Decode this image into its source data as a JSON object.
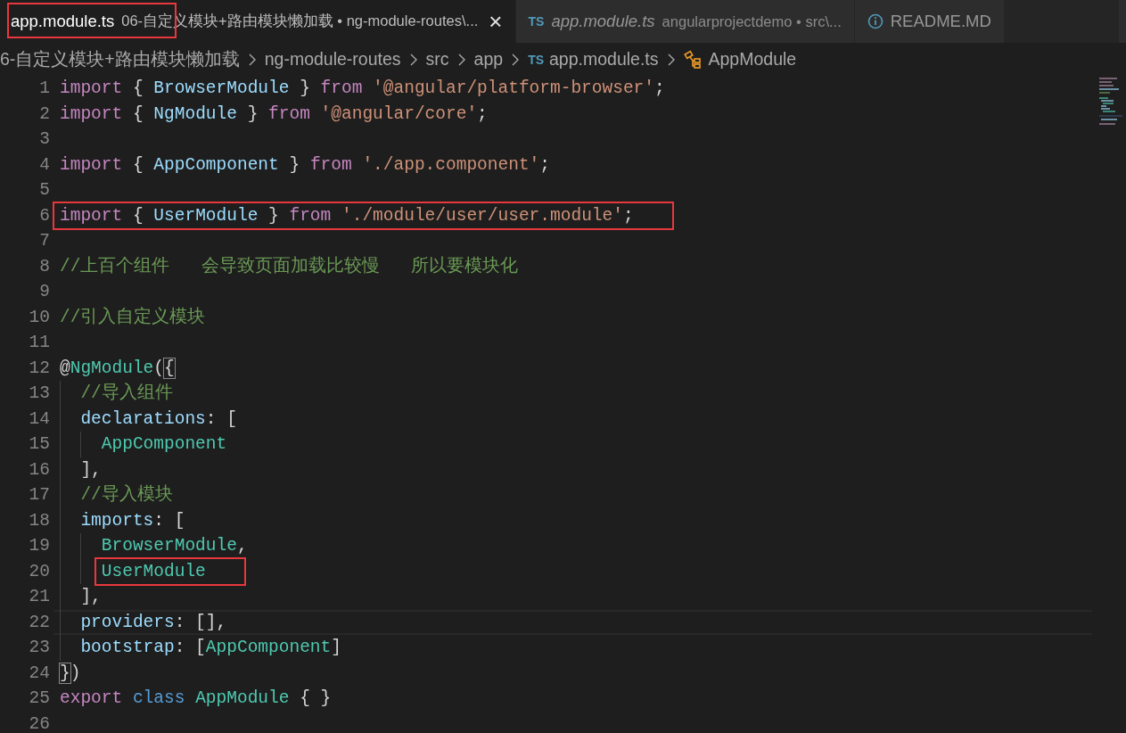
{
  "tabs": [
    {
      "kind": "plain",
      "name": "app.module.ts",
      "description": "06-自定义模块+路由模块懒加载 • ng-module-routes\\...",
      "selected": true,
      "italic": false,
      "highlighted": true,
      "close": "×"
    },
    {
      "kind": "ts",
      "icon": "TS",
      "name": "app.module.ts",
      "description": "angularprojectdemo • src\\...",
      "selected": false,
      "italic": true,
      "highlighted": false
    },
    {
      "kind": "info",
      "name": "README.MD",
      "selected": false,
      "italic": false,
      "highlighted": false
    }
  ],
  "breadcrumb": [
    {
      "kind": "folder",
      "label": "6-自定义模块+路由模块懒加载"
    },
    {
      "kind": "folder",
      "label": "ng-module-routes"
    },
    {
      "kind": "folder",
      "label": "src"
    },
    {
      "kind": "folder",
      "label": "app"
    },
    {
      "kind": "file",
      "icon": "TS",
      "label": "app.module.ts"
    },
    {
      "kind": "symbol",
      "label": "AppModule"
    }
  ],
  "lines": [
    {
      "number": "1",
      "highlighted": false,
      "current": false,
      "tokens": [
        {
          "kind": "keyword",
          "text": "import"
        },
        {
          "kind": "plain",
          "text": " { "
        },
        {
          "kind": "variable",
          "text": "BrowserModule"
        },
        {
          "kind": "plain",
          "text": " } "
        },
        {
          "kind": "keyword",
          "text": "from"
        },
        {
          "kind": "string",
          "text": " '@angular/platform-browser'"
        },
        {
          "kind": "plain",
          "text": ";"
        }
      ]
    },
    {
      "number": "2",
      "highlighted": false,
      "current": false,
      "tokens": [
        {
          "kind": "keyword",
          "text": "import"
        },
        {
          "kind": "plain",
          "text": " { "
        },
        {
          "kind": "variable",
          "text": "NgModule"
        },
        {
          "kind": "plain",
          "text": " } "
        },
        {
          "kind": "keyword",
          "text": "from"
        },
        {
          "kind": "string",
          "text": " '@angular/core'"
        },
        {
          "kind": "plain",
          "text": ";"
        }
      ]
    },
    {
      "number": "3",
      "highlighted": false,
      "current": false
    },
    {
      "number": "4",
      "highlighted": false,
      "current": false,
      "tokens": [
        {
          "kind": "keyword",
          "text": "import"
        },
        {
          "kind": "plain",
          "text": " { "
        },
        {
          "kind": "variable",
          "text": "AppComponent"
        },
        {
          "kind": "plain",
          "text": " } "
        },
        {
          "kind": "keyword",
          "text": "from"
        },
        {
          "kind": "string",
          "text": " './app.component'"
        },
        {
          "kind": "plain",
          "text": ";"
        }
      ]
    },
    {
      "number": "5",
      "highlighted": false,
      "current": false
    },
    {
      "number": "6",
      "highlighted": true,
      "current": false,
      "tokens": [
        {
          "kind": "keyword",
          "text": "import"
        },
        {
          "kind": "plain",
          "text": " { "
        },
        {
          "kind": "variable",
          "text": "UserModule"
        },
        {
          "kind": "plain",
          "text": " } "
        },
        {
          "kind": "keyword",
          "text": "from"
        },
        {
          "kind": "string",
          "text": " './module/user/user.module'"
        },
        {
          "kind": "plain",
          "text": ";"
        }
      ]
    },
    {
      "number": "7",
      "highlighted": false,
      "current": false
    },
    {
      "number": "8",
      "highlighted": false,
      "current": false,
      "tokens": [
        {
          "kind": "comment",
          "text": "//上百个组件   会导致页面加载比较慢   所以要模块化"
        }
      ]
    },
    {
      "number": "9",
      "highlighted": false,
      "current": false
    },
    {
      "number": "10",
      "highlighted": false,
      "current": false,
      "tokens": [
        {
          "kind": "comment",
          "text": "//引入自定义模块"
        }
      ]
    },
    {
      "number": "11",
      "highlighted": false,
      "current": false
    },
    {
      "number": "12",
      "highlighted": false,
      "current": false,
      "tokens": [
        {
          "kind": "plain",
          "text": "@"
        },
        {
          "kind": "type",
          "text": "NgModule"
        },
        {
          "kind": "plain",
          "text": "("
        },
        {
          "kind": "bracket",
          "text": "{"
        }
      ],
      "children": [
        {
          "number": "13",
          "highlighted": false,
          "current": false,
          "tokens": [
            {
              "kind": "comment",
              "text": "//导入组件"
            }
          ]
        },
        {
          "number": "14",
          "highlighted": false,
          "current": false,
          "tokens": [
            {
              "kind": "variable",
              "text": "declarations"
            },
            {
              "kind": "plain",
              "text": ": ["
            }
          ],
          "children": [
            {
              "number": "15",
              "highlighted": false,
              "current": false,
              "tokens": [
                {
                  "kind": "type",
                  "text": "AppComponent"
                }
              ]
            }
          ]
        },
        {
          "number": "16",
          "highlighted": false,
          "current": false,
          "tokens": [
            {
              "kind": "plain",
              "text": "],"
            }
          ]
        },
        {
          "number": "17",
          "highlighted": false,
          "current": false,
          "tokens": [
            {
              "kind": "comment",
              "text": "//导入模块"
            }
          ]
        },
        {
          "number": "18",
          "highlighted": false,
          "current": false,
          "tokens": [
            {
              "kind": "variable",
              "text": "imports"
            },
            {
              "kind": "plain",
              "text": ": ["
            }
          ],
          "children": [
            {
              "number": "19",
              "highlighted": false,
              "current": false,
              "tokens": [
                {
                  "kind": "type",
                  "text": "BrowserModule"
                },
                {
                  "kind": "plain",
                  "text": ","
                }
              ]
            },
            {
              "number": "20",
              "highlighted": true,
              "current": false,
              "tokens": [
                {
                  "kind": "type",
                  "text": "UserModule"
                }
              ]
            }
          ]
        },
        {
          "number": "21",
          "highlighted": false,
          "current": false,
          "tokens": [
            {
              "kind": "plain",
              "text": "],"
            }
          ]
        },
        {
          "number": "22",
          "highlighted": false,
          "current": true,
          "tokens": [
            {
              "kind": "variable",
              "text": "providers"
            },
            {
              "kind": "plain",
              "text": ": [],"
            }
          ]
        },
        {
          "number": "23",
          "highlighted": false,
          "current": false,
          "tokens": [
            {
              "kind": "variable",
              "text": "bootstrap"
            },
            {
              "kind": "plain",
              "text": ": ["
            },
            {
              "kind": "type",
              "text": "AppComponent"
            },
            {
              "kind": "plain",
              "text": "]"
            }
          ]
        }
      ]
    },
    {
      "number": "24",
      "highlighted": false,
      "current": false,
      "tokens": [
        {
          "kind": "bracket",
          "text": "}"
        },
        {
          "kind": "plain",
          "text": ")"
        }
      ]
    },
    {
      "number": "25",
      "highlighted": false,
      "current": false,
      "tokens": [
        {
          "kind": "keyword",
          "text": "export"
        },
        {
          "kind": "storage",
          "text": " class"
        },
        {
          "kind": "type",
          "text": " AppModule"
        },
        {
          "kind": "plain",
          "text": " { }"
        }
      ]
    },
    {
      "number": "26",
      "highlighted": false,
      "current": false
    }
  ]
}
